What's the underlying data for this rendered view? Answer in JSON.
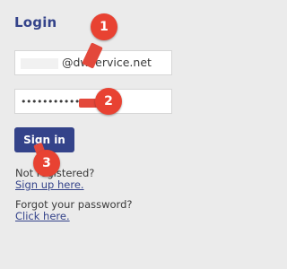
{
  "login": {
    "title": "Login",
    "email_value": "@dwservice.net",
    "password_value": "••••••••••••••",
    "signin_label": "Sign in",
    "not_registered_text": "Not registered?",
    "signup_link": "Sign up here.",
    "forgot_text": "Forgot your password?",
    "click_here_link": "Click here."
  },
  "markers": [
    "1",
    "2",
    "3"
  ],
  "colors": {
    "accent": "#34438a",
    "marker": "#e84232",
    "background": "#ebebeb"
  }
}
